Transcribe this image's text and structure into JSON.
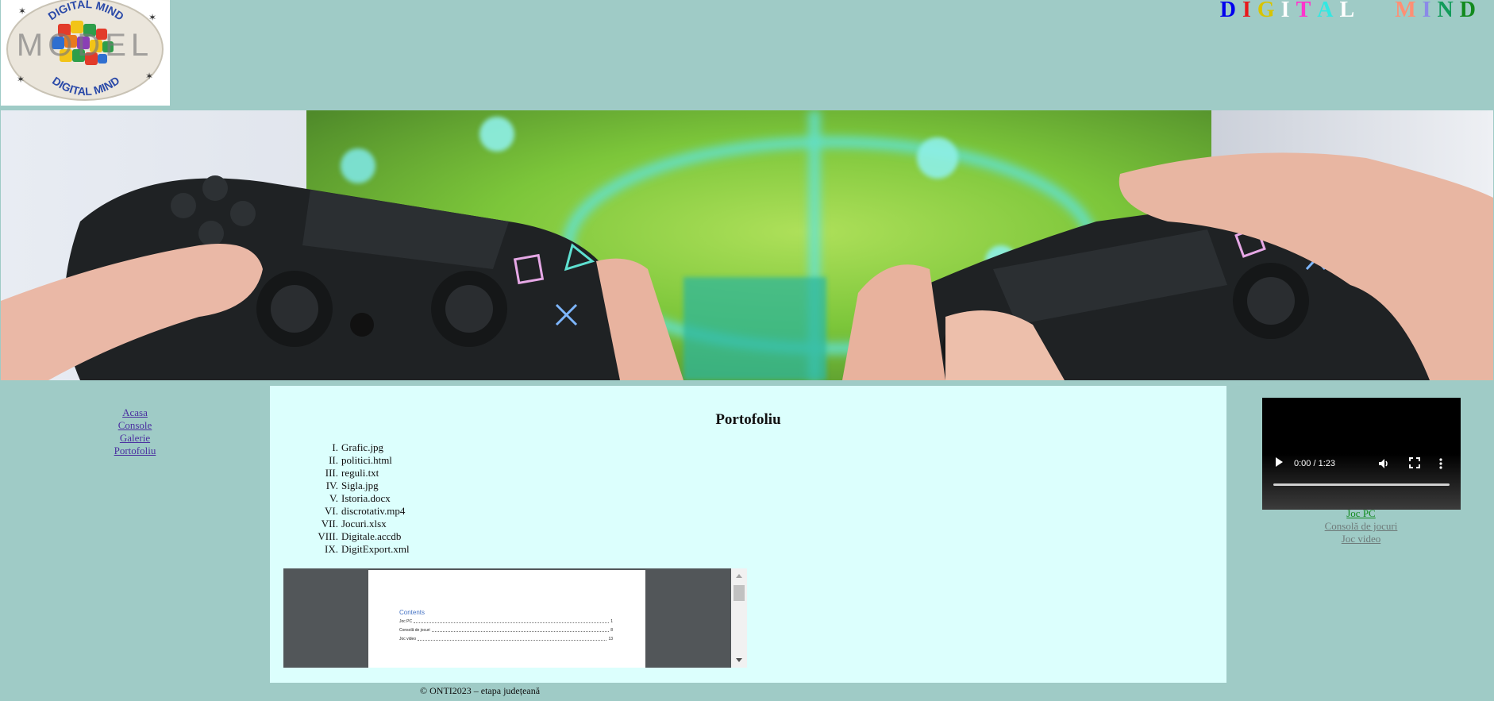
{
  "brand": {
    "letters": [
      {
        "ch": "D",
        "color": "#0000ee"
      },
      {
        "ch": "I",
        "color": "#e8191c"
      },
      {
        "ch": "G",
        "color": "#d8c400"
      },
      {
        "ch": "I",
        "color": "#ffffff"
      },
      {
        "ch": "T",
        "color": "#ff33cc"
      },
      {
        "ch": "A",
        "color": "#33e8e2"
      },
      {
        "ch": "L",
        "color": "#ffffff"
      },
      {
        "ch": "M",
        "color": "#ff8f74"
      },
      {
        "ch": "I",
        "color": "#8a8ae8"
      },
      {
        "ch": "N",
        "color": "#129b5a"
      },
      {
        "ch": "D",
        "color": "#128a1e"
      }
    ]
  },
  "logo": {
    "top_text": "DIGITAL MIND",
    "bottom_text": "DIGITAL MIND",
    "overlay_text": "MODEL"
  },
  "nav": {
    "items": [
      "Acasa",
      "Console",
      "Galerie",
      "Portofoliu"
    ]
  },
  "main": {
    "title": "Portofoliu",
    "files": [
      {
        "num": "I.",
        "name": "Grafic.jpg"
      },
      {
        "num": "II.",
        "name": "politici.html"
      },
      {
        "num": "III.",
        "name": "reguli.txt"
      },
      {
        "num": "IV.",
        "name": "Sigla.jpg"
      },
      {
        "num": "V.",
        "name": "Istoria.docx"
      },
      {
        "num": "VI.",
        "name": "discrotativ.mp4"
      },
      {
        "num": "VII.",
        "name": "Jocuri.xlsx"
      },
      {
        "num": "VIII.",
        "name": "Digitale.accdb"
      },
      {
        "num": "IX.",
        "name": "DigitExport.xml"
      }
    ],
    "document": {
      "heading": "Contents",
      "toc": [
        {
          "label": "Joc PC",
          "page": "1"
        },
        {
          "label": "Consolă de jocuri",
          "page": "8"
        },
        {
          "label": "Joc video",
          "page": "13"
        }
      ]
    }
  },
  "video": {
    "time": "0:00 / 1:23"
  },
  "right_links": [
    {
      "label": "Joc PC",
      "color": "#128a1e"
    },
    {
      "label": "Consolă de jocuri",
      "color": "#6e7a79"
    },
    {
      "label": "Joc video",
      "color": "#6e7a79"
    }
  ],
  "footer": {
    "text": "© ONTI2023 – etapa județeană"
  }
}
